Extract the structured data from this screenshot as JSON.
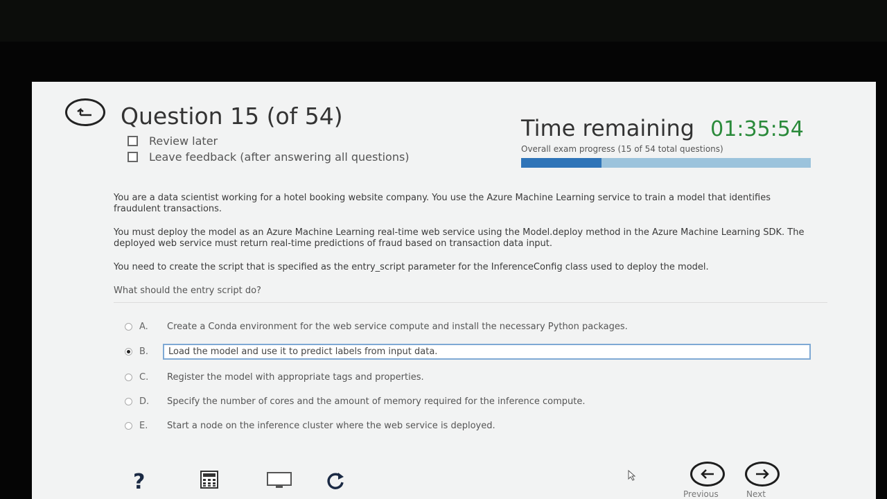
{
  "header": {
    "question_title": "Question 15 (of 54)",
    "review_later": "Review later",
    "leave_feedback": "Leave feedback (after answering all questions)",
    "time_label": "Time remaining",
    "time_value": "01:35:54",
    "progress_text": "Overall exam progress (15 of 54 total questions)",
    "progress_fraction": 0.278
  },
  "question": {
    "paragraphs": [
      "You are a data scientist working for a hotel booking website company. You use the Azure Machine Learning service to train a model that identifies fraudulent transactions.",
      "You must deploy the model as an Azure Machine Learning real-time web service using the Model.deploy method in the Azure Machine Learning SDK. The deployed web service must return real-time predictions of fraud based on transaction data input.",
      "You need to create the script that is specified as the entry_script parameter for the InferenceConfig class used to deploy the model."
    ],
    "prompt": "What should the entry script do?"
  },
  "options": [
    {
      "letter": "A.",
      "text": "Create a Conda environment for the web service compute and install the necessary Python packages.",
      "selected": false
    },
    {
      "letter": "B.",
      "text": "Load the model and use it to predict labels from input data.",
      "selected": true
    },
    {
      "letter": "C.",
      "text": "Register the model with appropriate tags and properties.",
      "selected": false
    },
    {
      "letter": "D.",
      "text": "Specify the number of cores and the amount of memory required for the inference compute.",
      "selected": false
    },
    {
      "letter": "E.",
      "text": "Start a node on the inference cluster where the web service is deployed.",
      "selected": false
    }
  ],
  "footer": {
    "help_symbol": "?",
    "previous_label": "Previous",
    "next_label": "Next",
    "icons": [
      "help-icon",
      "calculator-icon",
      "monitor-icon",
      "refresh-icon",
      "previous-arrow-icon",
      "next-arrow-icon"
    ]
  }
}
